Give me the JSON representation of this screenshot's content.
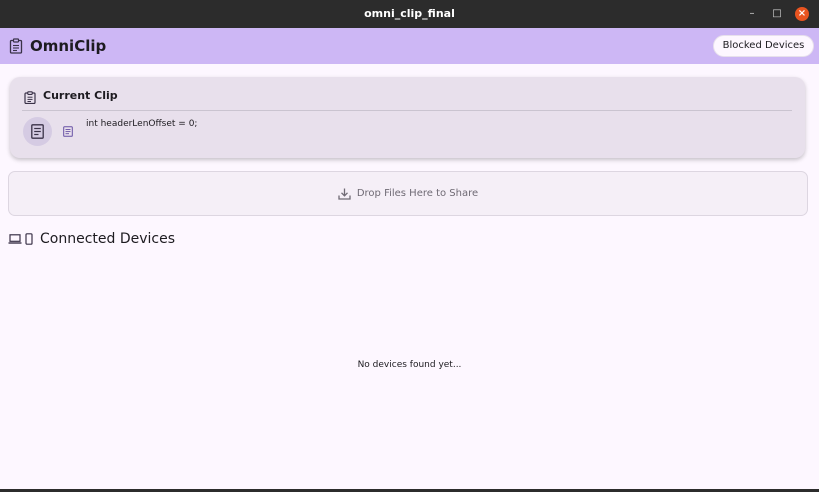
{
  "window": {
    "title": "omni_clip_final",
    "minimize_glyph": "–",
    "maximize_glyph": "□",
    "close_glyph": "×"
  },
  "appbar": {
    "title": "OmniClip",
    "icon": "clipboard-icon",
    "blocked_button_label": "Blocked Devices"
  },
  "current_clip": {
    "title": "Current Clip",
    "icon": "clipboard-icon",
    "content": "int headerLenOffset = 0;",
    "item_icon": "text-document-icon"
  },
  "dropzone": {
    "label": "Drop Files Here to Share",
    "icon": "download-tray-icon"
  },
  "devices": {
    "title": "Connected Devices",
    "icons": [
      "laptop-icon",
      "phone-icon"
    ],
    "empty_message": "No devices found yet..."
  },
  "colors": {
    "titlebar_bg": "#2c2c2c",
    "appbar_bg": "#cdb7f5",
    "page_bg": "#fdf7ff",
    "card_bg": "#e8e0ec",
    "accent": "#6750a4",
    "close_button": "#e95420"
  }
}
